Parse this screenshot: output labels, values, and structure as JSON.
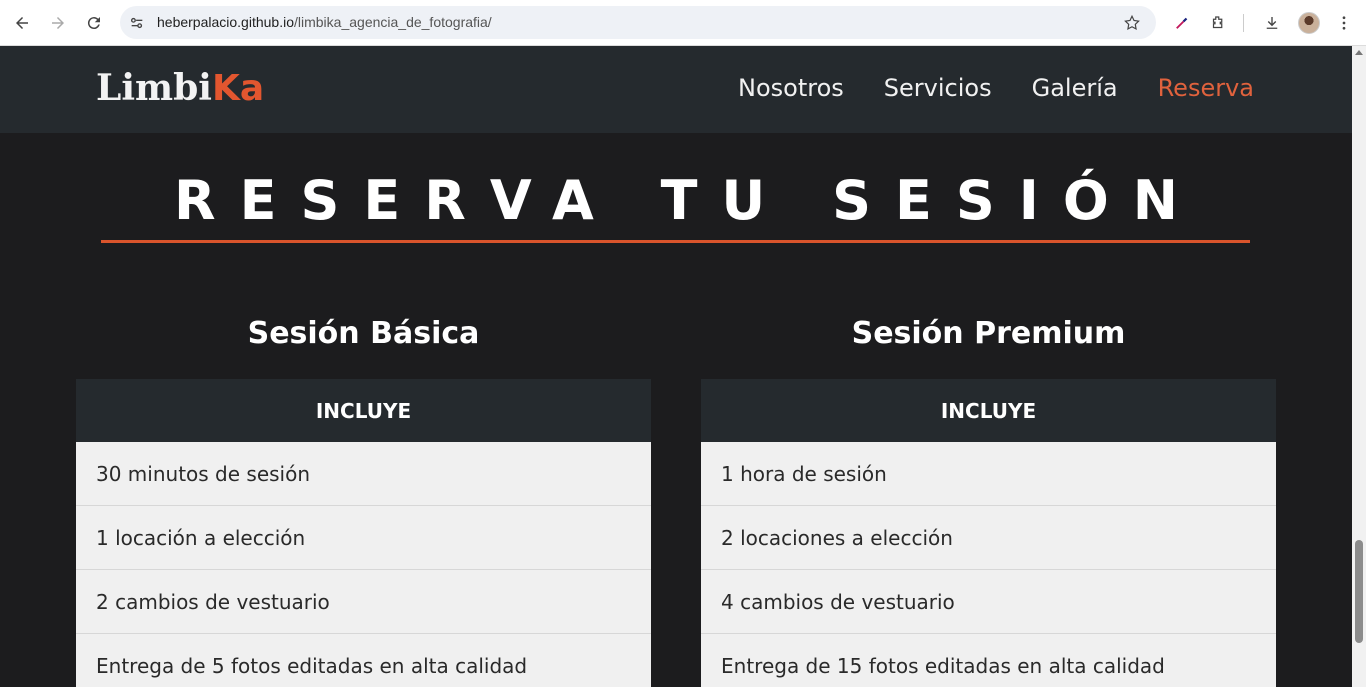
{
  "browser": {
    "url_host": "heberpalacio.github.io",
    "url_path": "/limbika_agencia_de_fotografia/",
    "icons": [
      "back-icon",
      "forward-icon",
      "reload-icon",
      "site-settings-icon",
      "bookmark-star-icon",
      "eyedropper-icon",
      "extensions-icon",
      "download-icon",
      "profile-avatar",
      "menu-icon"
    ]
  },
  "site": {
    "logo_main": "Limbi",
    "logo_accent": "Ka",
    "nav": [
      {
        "label": "Nosotros"
      },
      {
        "label": "Servicios"
      },
      {
        "label": "Galería"
      },
      {
        "label": "Reserva",
        "active": true
      }
    ],
    "accent_color": "#e2562f"
  },
  "section": {
    "title": "RESERVA TU SESIÓN"
  },
  "plans": [
    {
      "name": "Sesión Básica",
      "header": "INCLUYE",
      "items": [
        "30 minutos de sesión",
        "1 locación a elección",
        "2 cambios de vestuario",
        "Entrega de 5 fotos editadas en alta calidad"
      ]
    },
    {
      "name": "Sesión Premium",
      "header": "INCLUYE",
      "items": [
        "1 hora de sesión",
        "2 locaciones a elección",
        "4 cambios de vestuario",
        "Entrega de 15 fotos editadas en alta calidad"
      ]
    }
  ]
}
